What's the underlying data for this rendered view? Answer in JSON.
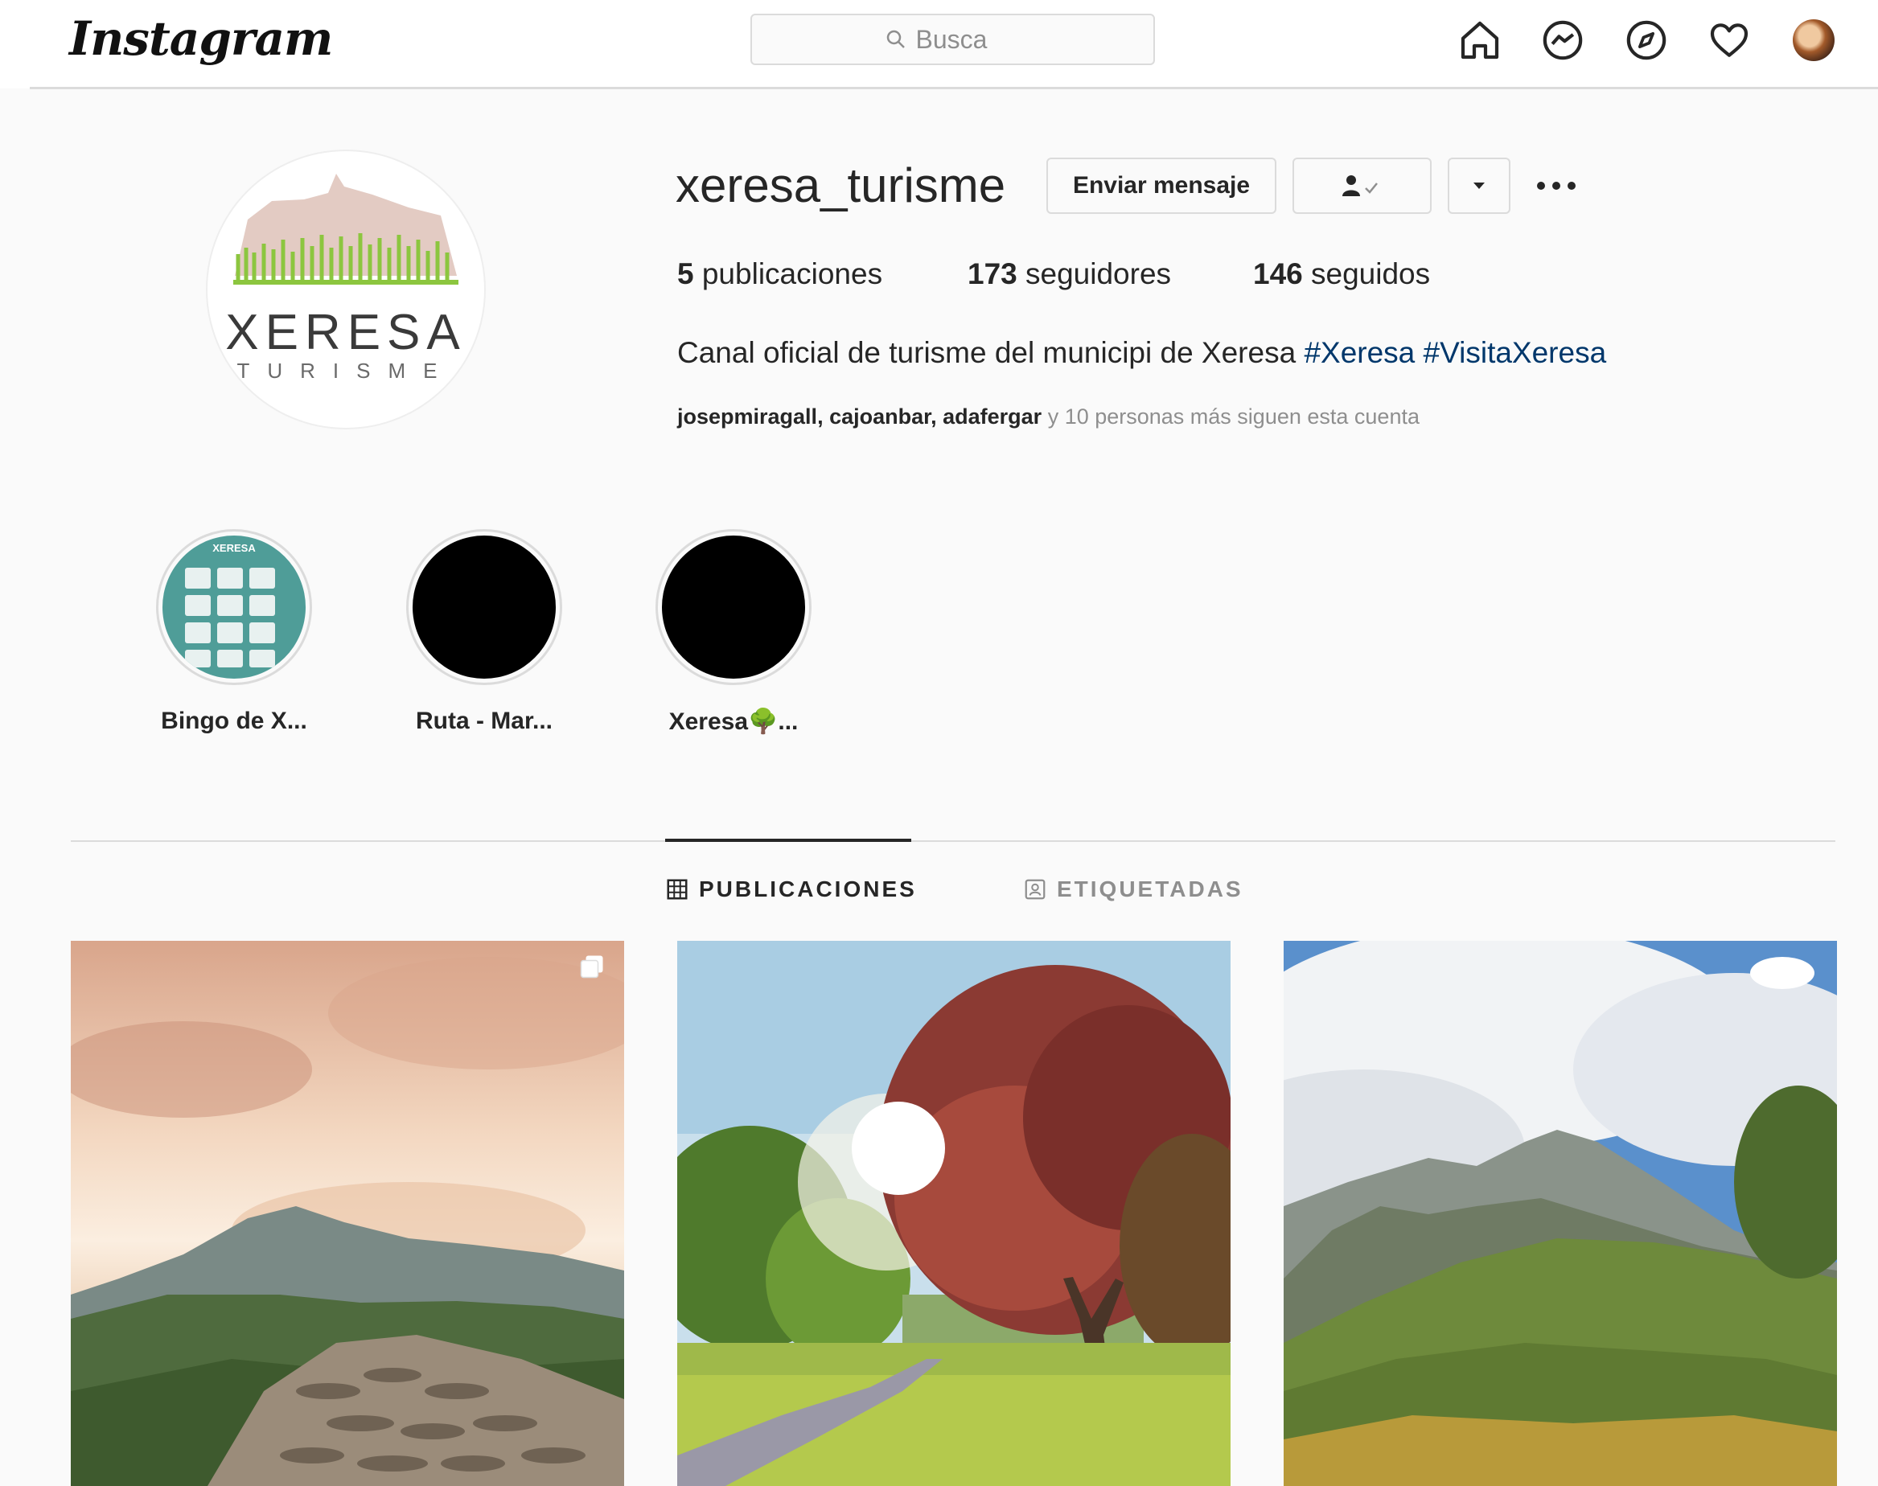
{
  "topbar": {
    "logo": "Instagram",
    "search_placeholder": "Busca"
  },
  "profile": {
    "username": "xeresa_turisme",
    "message_button": "Enviar mensaje",
    "logo_main": "XERESA",
    "logo_sub": "TURISME",
    "stats": [
      {
        "count": "5",
        "label": "publicaciones"
      },
      {
        "count": "173",
        "label": "seguidores"
      },
      {
        "count": "146",
        "label": "seguidos"
      }
    ],
    "bio_text": "Canal oficial de turisme del municipi de Xeresa ",
    "bio_tags": "#Xeresa #VisitaXeresa",
    "followed_names": "josepmiragall, cajoanbar, adafergar",
    "followed_suffix": " y 10 personas más siguen esta cuenta"
  },
  "highlights": [
    {
      "label": "Bingo de X...",
      "cover_title": "XERESA"
    },
    {
      "label": "Ruta - Mar..."
    },
    {
      "label": "Xeresa🌳..."
    }
  ],
  "tabs": [
    {
      "label": "PUBLICACIONES",
      "active": true
    },
    {
      "label": "ETIQUETADAS",
      "active": false
    }
  ],
  "colors": {
    "accent_link": "#00376b",
    "border": "#dbdbdb",
    "text": "#262626",
    "muted": "#8e8e8e"
  },
  "icons": [
    "home-icon",
    "messenger-icon",
    "explore-icon",
    "heart-icon",
    "search-icon",
    "more-icon",
    "caret-down-icon",
    "person-check-icon",
    "grid-icon",
    "tag-icon",
    "carousel-icon"
  ]
}
